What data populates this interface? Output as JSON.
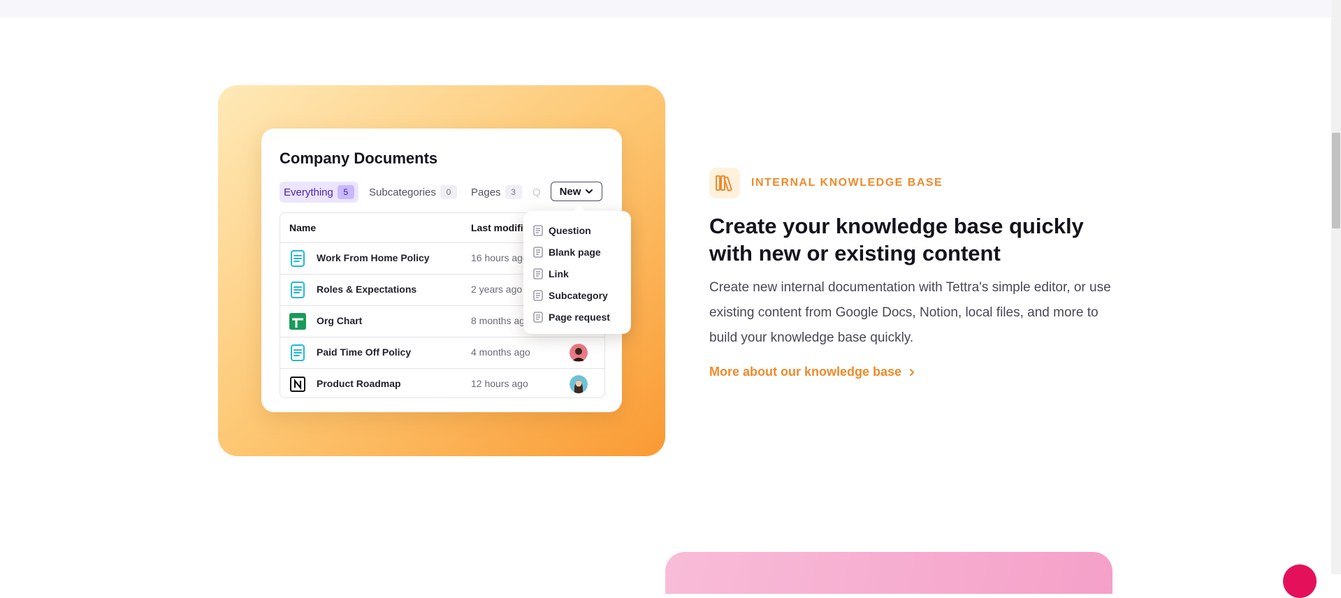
{
  "visual": {
    "card_title": "Company Documents",
    "tabs": [
      {
        "label": "Everything",
        "count": "5"
      },
      {
        "label": "Subcategories",
        "count": "0"
      },
      {
        "label": "Pages",
        "count": "3"
      }
    ],
    "tab_overflow": "Q",
    "new_button": "New",
    "table": {
      "headers": [
        "Name",
        "Last modified"
      ],
      "rows": [
        {
          "name": "Work From Home Policy",
          "time": "16 hours ago",
          "icon": "google-doc-icon"
        },
        {
          "name": "Roles & Expectations",
          "time": "2 years ago",
          "icon": "google-doc-icon"
        },
        {
          "name": "Org Chart",
          "time": "8 months ago",
          "icon": "google-sheets-icon"
        },
        {
          "name": "Paid Time Off Policy",
          "time": "4 months ago",
          "icon": "google-doc-icon"
        },
        {
          "name": "Product Roadmap",
          "time": "12 hours ago",
          "icon": "notion-icon"
        }
      ]
    },
    "dropdown": [
      "Question",
      "Blank page",
      "Link",
      "Subcategory",
      "Page request"
    ]
  },
  "feature": {
    "eyebrow": "INTERNAL KNOWLEDGE BASE",
    "eyebrow_icon": "books-icon",
    "headline": "Create your knowledge base quickly with new or existing content",
    "body": "Create new internal documentation with Tettra's simple editor, or use existing content from Google Docs, Notion, local files, and more to build your knowledge base quickly.",
    "link": "More about our knowledge base"
  },
  "colors": {
    "accent": "#ef8a2b",
    "tab_active": "#4b1fb8",
    "gradient_start": "#fee9b7",
    "gradient_end": "#fa9a33"
  }
}
